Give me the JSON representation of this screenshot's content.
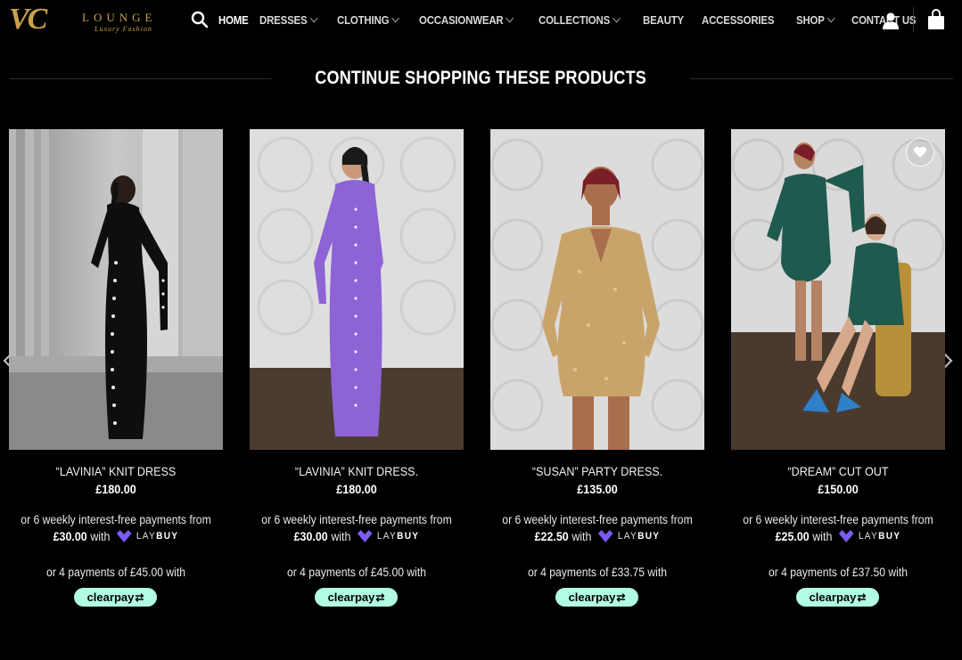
{
  "brand": {
    "logo_mark": "VC",
    "logo_word": "LOUNGE",
    "logo_tagline": "Luxury Fashion",
    "accent_color": "#c9a24a"
  },
  "nav": {
    "items": [
      {
        "label": "HOME",
        "dropdown": false
      },
      {
        "label": "DRESSES",
        "dropdown": true
      },
      {
        "label": "CLOTHING",
        "dropdown": true
      },
      {
        "label": "OCCASIONWEAR",
        "dropdown": true
      },
      {
        "label": "COLLECTIONS",
        "dropdown": true
      },
      {
        "label": "BEAUTY",
        "dropdown": false
      },
      {
        "label": "ACCESSORIES",
        "dropdown": false
      },
      {
        "label": "SHOP",
        "dropdown": true
      },
      {
        "label": "CONTACT US",
        "dropdown": false
      }
    ],
    "icons": [
      "search-icon",
      "account-icon",
      "shopping-bag-icon"
    ]
  },
  "section": {
    "title": "CONTINUE SHOPPING THESE PRODUCTS"
  },
  "products": [
    {
      "name": "“LAVINIA” KNIT DRESS",
      "price": "£180.00",
      "laybuy_intro": "or 6 weekly interest-free payments from",
      "laybuy_amount": "£30.00",
      "laybuy_with": "with",
      "clearpay_text": "or 4 payments of £45.00 with",
      "dress_color": "#111111"
    },
    {
      "name": "“LAVINIA” KNIT DRESS.",
      "price": "£180.00",
      "laybuy_intro": "or 6 weekly interest-free payments from",
      "laybuy_amount": "£30.00",
      "laybuy_with": "with",
      "clearpay_text": "or 4 payments of £45.00 with",
      "dress_color": "#8d63d6"
    },
    {
      "name": "“SUSAN” PARTY DRESS.",
      "price": "£135.00",
      "laybuy_intro": "or 6 weekly interest-free payments from",
      "laybuy_amount": "£22.50",
      "laybuy_with": "with",
      "clearpay_text": "or 4 payments of £33.75 with",
      "dress_color": "#c9a46a"
    },
    {
      "name": "“DREAM” CUT OUT",
      "price": "£150.00",
      "laybuy_intro": "or 6 weekly interest-free payments from",
      "laybuy_amount": "£25.00",
      "laybuy_with": "with",
      "clearpay_text": "or 4 payments of £37.50 with",
      "dress_color": "#1f5a4e"
    }
  ],
  "payment": {
    "laybuy_label_light": "LAY",
    "laybuy_label_bold": "BUY",
    "laybuy_color": "#7b5cf5",
    "clearpay_label": "clearpay",
    "clearpay_color": "#b2fce4"
  },
  "carousel": {
    "icons": [
      "chevron-left-icon",
      "chevron-right-icon",
      "heart-icon"
    ]
  }
}
